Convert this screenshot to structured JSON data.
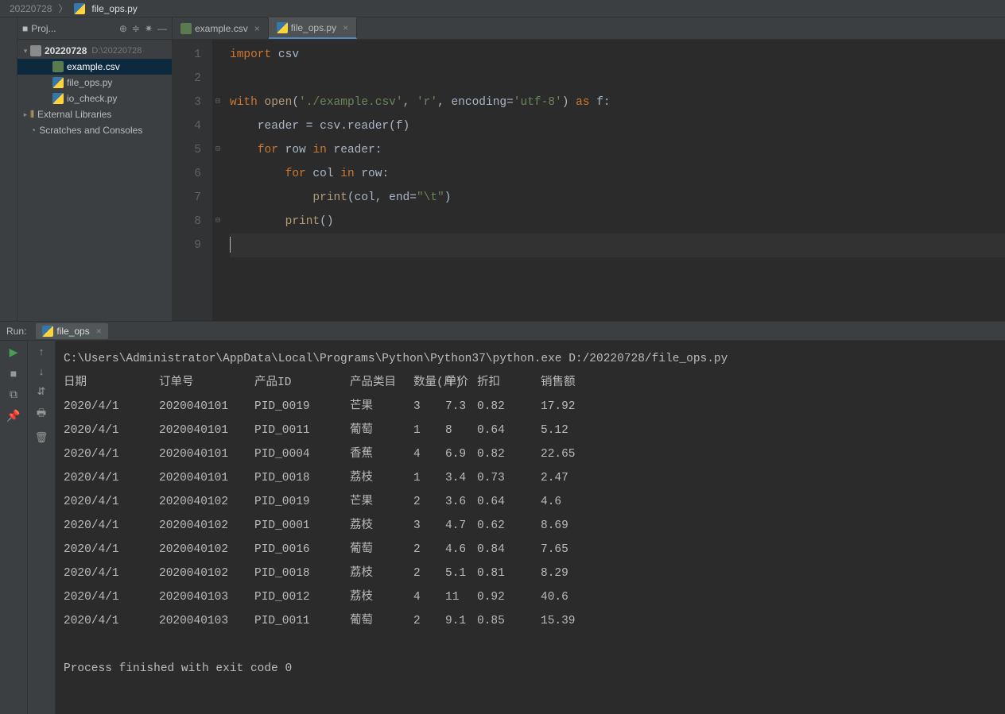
{
  "breadcrumb": {
    "root": "20220728",
    "file": "file_ops.py"
  },
  "projectPanel": {
    "title": "Proj...",
    "root": {
      "name": "20220728",
      "path": "D:\\20220728"
    },
    "files": [
      {
        "name": "example.csv",
        "type": "csv",
        "selected": true
      },
      {
        "name": "file_ops.py",
        "type": "py"
      },
      {
        "name": "io_check.py",
        "type": "py"
      }
    ],
    "external": "External Libraries",
    "scratches": "Scratches and Consoles"
  },
  "tabs": [
    {
      "name": "example.csv",
      "type": "csv",
      "active": false
    },
    {
      "name": "file_ops.py",
      "type": "py",
      "active": true
    }
  ],
  "code": {
    "lines": [
      {
        "n": 1,
        "tokens": [
          [
            "k",
            "import"
          ],
          [
            "p",
            " csv"
          ]
        ]
      },
      {
        "n": 2,
        "tokens": []
      },
      {
        "n": 3,
        "fold": "⊟",
        "tokens": [
          [
            "k",
            "with"
          ],
          [
            "p",
            " "
          ],
          [
            "fn",
            "open"
          ],
          [
            "p",
            "("
          ],
          [
            "s",
            "'./example.csv'"
          ],
          [
            "p",
            ", "
          ],
          [
            "s",
            "'r'"
          ],
          [
            "p",
            ", encoding="
          ],
          [
            "s",
            "'utf-8'"
          ],
          [
            "p",
            ") "
          ],
          [
            "k",
            "as"
          ],
          [
            "p",
            " f:"
          ]
        ]
      },
      {
        "n": 4,
        "tokens": [
          [
            "p",
            "    reader = csv.reader(f)"
          ]
        ]
      },
      {
        "n": 5,
        "fold": "⊟",
        "tokens": [
          [
            "p",
            "    "
          ],
          [
            "k",
            "for"
          ],
          [
            "p",
            " row "
          ],
          [
            "k",
            "in"
          ],
          [
            "p",
            " reader:"
          ]
        ]
      },
      {
        "n": 6,
        "tokens": [
          [
            "p",
            "        "
          ],
          [
            "k",
            "for"
          ],
          [
            "p",
            " col "
          ],
          [
            "k",
            "in"
          ],
          [
            "p",
            " row:"
          ]
        ]
      },
      {
        "n": 7,
        "tokens": [
          [
            "p",
            "            "
          ],
          [
            "fn",
            "print"
          ],
          [
            "p",
            "(col, end="
          ],
          [
            "s",
            "\"\\t\""
          ],
          [
            "p",
            ")"
          ]
        ]
      },
      {
        "n": 8,
        "fold": "⊟",
        "tokens": [
          [
            "p",
            "        "
          ],
          [
            "fn",
            "print"
          ],
          [
            "p",
            "()"
          ]
        ]
      },
      {
        "n": 9,
        "current": true,
        "tokens": []
      }
    ]
  },
  "run": {
    "label": "Run:",
    "tab": "file_ops",
    "command": "C:\\Users\\Administrator\\AppData\\Local\\Programs\\Python\\Python37\\python.exe D:/20220728/file_ops.py",
    "headers": [
      "日期",
      "订单号",
      "产品ID",
      "产品类目",
      "数量(斤)",
      "",
      "单价",
      "折扣",
      "",
      "销售额"
    ],
    "headerCells": [
      "日期",
      "订单号",
      "产品ID",
      "产品类目",
      "数量(斤)",
      "单价",
      "折扣",
      "销售额"
    ],
    "rows": [
      [
        "2020/4/1",
        "2020040101",
        "PID_0019",
        "芒果",
        "3",
        "7.3",
        "0.82",
        "17.92"
      ],
      [
        "2020/4/1",
        "2020040101",
        "PID_0011",
        "葡萄",
        "1",
        "8",
        "0.64",
        "5.12"
      ],
      [
        "2020/4/1",
        "2020040101",
        "PID_0004",
        "香蕉",
        "4",
        "6.9",
        "0.82",
        "22.65"
      ],
      [
        "2020/4/1",
        "2020040101",
        "PID_0018",
        "荔枝",
        "1",
        "3.4",
        "0.73",
        "2.47"
      ],
      [
        "2020/4/1",
        "2020040102",
        "PID_0019",
        "芒果",
        "2",
        "3.6",
        "0.64",
        "4.6"
      ],
      [
        "2020/4/1",
        "2020040102",
        "PID_0001",
        "荔枝",
        "3",
        "4.7",
        "0.62",
        "8.69"
      ],
      [
        "2020/4/1",
        "2020040102",
        "PID_0016",
        "葡萄",
        "2",
        "4.6",
        "0.84",
        "7.65"
      ],
      [
        "2020/4/1",
        "2020040102",
        "PID_0018",
        "荔枝",
        "2",
        "5.1",
        "0.81",
        "8.29"
      ],
      [
        "2020/4/1",
        "2020040103",
        "PID_0012",
        "荔枝",
        "4",
        "11",
        "0.92",
        "40.6"
      ],
      [
        "2020/4/1",
        "2020040103",
        "PID_0011",
        "葡萄",
        "2",
        "9.1",
        "0.85",
        "15.39"
      ]
    ],
    "exit": "Process finished with exit code 0"
  }
}
